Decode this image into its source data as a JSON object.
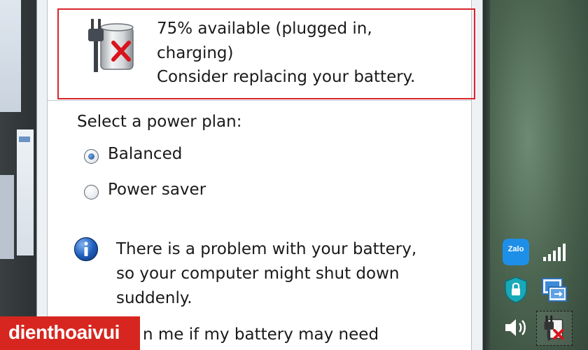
{
  "battery_status": {
    "line1": "75% available (plugged in,",
    "line2": "charging)",
    "line3": "Consider replacing your battery."
  },
  "power_plan": {
    "title": "Select a power plan:",
    "options": [
      {
        "label": "Balanced",
        "selected": true
      },
      {
        "label": "Power saver",
        "selected": false
      }
    ]
  },
  "warning": {
    "lines": [
      "There is a problem with your battery,",
      "so your computer might shut down",
      "suddenly."
    ]
  },
  "notify_partial": "n me if my battery may need",
  "watermark": "dienthoaivui",
  "tray": {
    "zalo_label": "Zalo",
    "icons": [
      "zalo-icon",
      "network-signal-icon",
      "security-shield-icon",
      "remote-connection-icon",
      "volume-icon",
      "battery-power-icon"
    ]
  },
  "colors": {
    "highlight_border": "#d9262c",
    "logo_background": "#d7261f",
    "info_blue": "#1f5fbf"
  }
}
